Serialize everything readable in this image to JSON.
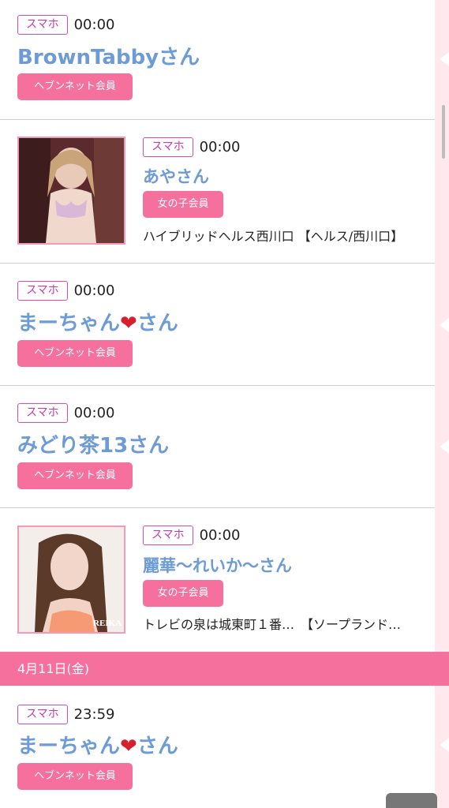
{
  "entries_before": [
    {
      "device": "スマホ",
      "time": "00:00",
      "name": "BrownTabbyさん",
      "member": "ヘブンネット会員"
    },
    {
      "device": "スマホ",
      "time": "00:00",
      "name": "あやさん",
      "member": "女の子会員",
      "shop": "ハイブリッドヘルス西川口 【ヘルス/西川口】"
    },
    {
      "device": "スマホ",
      "time": "00:00",
      "name_prefix": "まーちゃん",
      "name_heart": "❤",
      "name_suffix": "さん",
      "member": "ヘブンネット会員"
    },
    {
      "device": "スマホ",
      "time": "00:00",
      "name": "みどり茶13さん",
      "member": "ヘブンネット会員"
    },
    {
      "device": "スマホ",
      "time": "00:00",
      "name": "麗華〜れいか〜さん",
      "member": "女の子会員",
      "shop": "トレビの泉は城東町１番…　【ソープランド…",
      "photo_watermark": "REIKA"
    }
  ],
  "date_header": "4月11日(金)",
  "entries_after": [
    {
      "device": "スマホ",
      "time": "23:59",
      "name_prefix": "まーちゃん",
      "name_heart": "❤",
      "name_suffix": "さん",
      "member": "ヘブンネット会員"
    }
  ],
  "colors": {
    "accent_pink": "#f5709c",
    "name_blue": "#6c9bd6",
    "tag_magenta": "#d94bb2",
    "rail_pink": "#ffe9ee"
  },
  "icons": {
    "back_to_top": "back-to-top-icon",
    "rail_arrow": "chevron-left-icon"
  }
}
